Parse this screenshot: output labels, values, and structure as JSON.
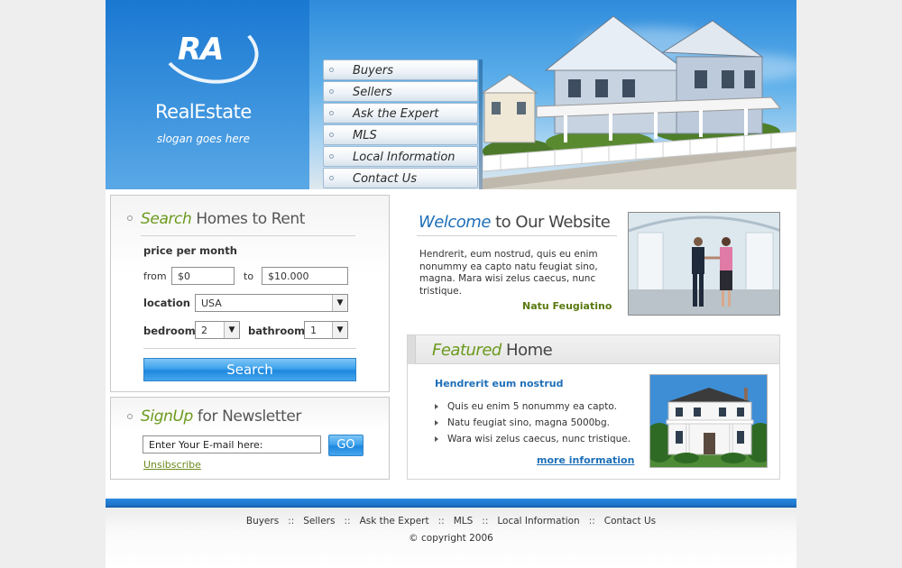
{
  "header": {
    "logo_text": "RA",
    "brand_name": "RealEstate",
    "slogan": "slogan goes here",
    "nav": [
      {
        "label": "Buyers"
      },
      {
        "label": "Sellers"
      },
      {
        "label": "Ask the Expert"
      },
      {
        "label": "MLS"
      },
      {
        "label": "Local Information"
      },
      {
        "label": "Contact Us"
      }
    ]
  },
  "search": {
    "title_highlight": "Search",
    "title_rest": " Homes to Rent",
    "price_label": "price per month",
    "from_label": "from",
    "from_value": "$0",
    "to_label": "to",
    "to_value": "$10.000",
    "location_label": "location",
    "location_value": "USA",
    "bedroom_label": "bedroom",
    "bedroom_value": "2",
    "bathroom_label": "bathroom",
    "bathroom_value": "1",
    "button_label": "Search"
  },
  "newsletter": {
    "title_highlight": "SignUp",
    "title_rest": " for Newsletter",
    "email_placeholder": "Enter Your E-mail here:",
    "go_label": "GO",
    "unsubscribe_label": "Unsibscribe"
  },
  "welcome": {
    "title_highlight": "Welcome",
    "title_rest": " to Our Website",
    "text": "Hendrerit, eum nostrud, quis eu enim nonummy ea capto natu feugiat sino, magna. Mara wisi zelus caecus, nunc tristique.",
    "signature": "Natu Feugiatino"
  },
  "featured": {
    "title_highlight": "Featured",
    "title_rest": " Home",
    "subtitle": "Hendrerit eum nostrud",
    "items": [
      "Quis eu enim 5 nonummy ea capto.",
      "Natu feugiat sino, magna 5000bg.",
      "Wara wisi zelus caecus, nunc tristique."
    ],
    "more_label": "more information"
  },
  "footer": {
    "links": [
      "Buyers",
      "Sellers",
      "Ask the Expert",
      "MLS",
      "Local Information",
      "Contact Us"
    ],
    "separator": "::",
    "copyright": "© copyright 2006"
  }
}
